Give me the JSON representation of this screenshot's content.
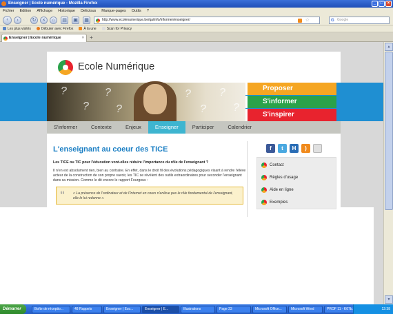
{
  "window": {
    "title": "Enseigner | Ecole numérique - Mozilla Firefox"
  },
  "menu": [
    "Fichier",
    "Edition",
    "Affichage",
    "Historique",
    "Delicious",
    "Marque-pages",
    "Outils",
    "?"
  ],
  "address": {
    "url": "http://www.ecolenumerique.be/qa/info/informer/enseigner/",
    "search_placeholder": "Google"
  },
  "bookmarks": [
    "Les plus visités",
    "Débuter avec Firefox",
    "À la une",
    "Scan for Privacy"
  ],
  "tab": {
    "label": "Enseigner | Ecole numérique",
    "close": "×",
    "new": "+"
  },
  "site": {
    "brand": "Ecole Numérique",
    "pills": [
      "Proposer",
      "S'informer",
      "S'inspirer"
    ],
    "nav": [
      {
        "label": "S'informer",
        "active": false
      },
      {
        "label": "Contexte",
        "active": false
      },
      {
        "label": "Enjeux",
        "active": false
      },
      {
        "label": "Enseigner",
        "active": true
      },
      {
        "label": "Participer",
        "active": false
      },
      {
        "label": "Calendrier",
        "active": false
      }
    ],
    "heading": "L'enseignant au coeur des TICE",
    "lede": "Les TICE ou TIC pour l'éducation vont-elles réduire l'importance du rôle de l'enseignant ?",
    "body": "Il n'en est absolument rien, bien au contraire. En effet, dans le droit fil des évolutions pédagogiques visant à rendre l'élève acteur de la construction de son propre savoir, les TIC se révèlent des outils extraordinaires pour seconder l'enseignant dans sa mission. Comme le dit encore le rapport Fourgous :",
    "quote": "« La présence de l'ordinateur et de l'Internet en cours n'enlève pas le rôle fondamental de l'enseignant, elle le lui redonne ».",
    "socials": [
      {
        "name": "facebook-icon",
        "glyph": "f",
        "color": "#3b5998"
      },
      {
        "name": "twitter-icon",
        "glyph": "t",
        "color": "#4aa8e0"
      },
      {
        "name": "hyves-icon",
        "glyph": "H",
        "color": "#2a6db5"
      },
      {
        "name": "rss-icon",
        "glyph": ")",
        "color": "#f08a1c"
      },
      {
        "name": "share-icon",
        "glyph": "",
        "color": "#b8b8b8"
      }
    ],
    "sidebar": [
      "Contact",
      "Règles d'usage",
      "Aide en ligne",
      "Exemples"
    ]
  },
  "taskbar": {
    "start": "Démarrer",
    "tasks": [
      "Boîte de réceptio...",
      "48 Rappels",
      "Enseigner | Eco...",
      "Enseigner | E...",
      "Illustrations",
      "Page 23",
      "Microsoft Office...",
      "Microsoft Word",
      "PROF 11 - K07b..."
    ],
    "active_index": 3,
    "clock": "12:38"
  }
}
